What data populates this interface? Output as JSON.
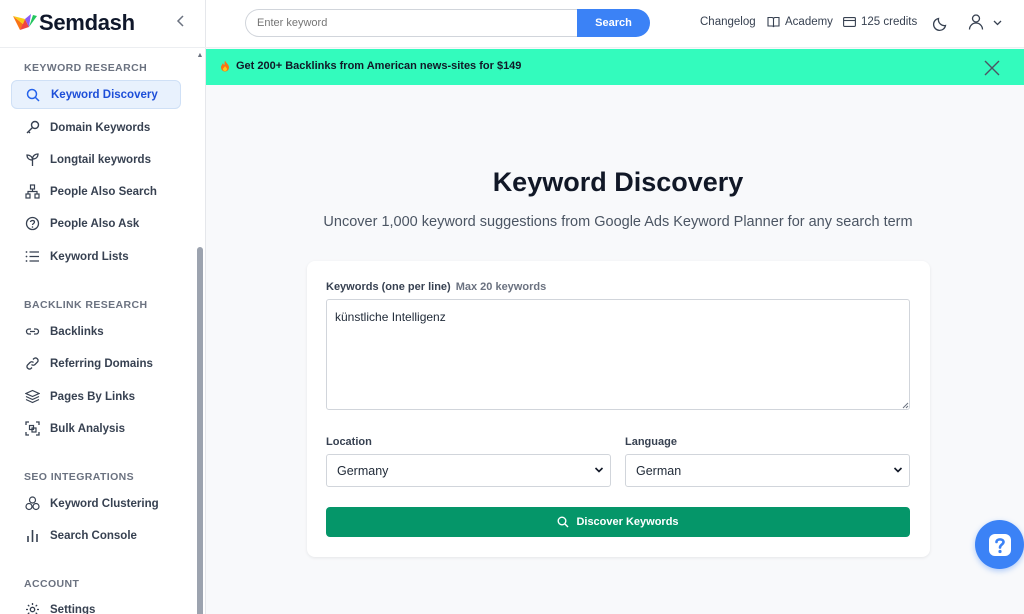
{
  "brand": {
    "name": "Semdash"
  },
  "topbar": {
    "search_placeholder": "Enter keyword",
    "search_button": "Search",
    "changelog": "Changelog",
    "academy": "Academy",
    "credits": "125 credits"
  },
  "banner": {
    "text": "Get 200+ Backlinks from American news-sites for $149"
  },
  "sidebar": {
    "sections": [
      {
        "title": "KEYWORD RESEARCH"
      },
      {
        "title": "BACKLINK RESEARCH"
      },
      {
        "title": "SEO INTEGRATIONS"
      },
      {
        "title": "ACCOUNT"
      }
    ],
    "items": [
      {
        "label": "Keyword Discovery",
        "icon": "search-icon"
      },
      {
        "label": "Domain Keywords",
        "icon": "key-icon"
      },
      {
        "label": "Longtail keywords",
        "icon": "sprout-icon"
      },
      {
        "label": "People Also Search",
        "icon": "network-icon"
      },
      {
        "label": "People Also Ask",
        "icon": "question-circle-icon"
      },
      {
        "label": "Keyword Lists",
        "icon": "list-icon"
      },
      {
        "label": "Backlinks",
        "icon": "link-icon"
      },
      {
        "label": "Referring Domains",
        "icon": "chain-icon"
      },
      {
        "label": "Pages By Links",
        "icon": "layers-icon"
      },
      {
        "label": "Bulk Analysis",
        "icon": "scan-icon"
      },
      {
        "label": "Keyword Clustering",
        "icon": "cluster-icon"
      },
      {
        "label": "Search Console",
        "icon": "bar-chart-icon"
      },
      {
        "label": "Settings",
        "icon": "gear-icon"
      }
    ]
  },
  "main": {
    "title": "Keyword Discovery",
    "subtitle": "Uncover 1,000 keyword suggestions from Google Ads Keyword Planner for any search term",
    "keywords_label": "Keywords (one per line)",
    "keywords_hint": "Max 20 keywords",
    "keywords_value": "künstliche Intelligenz",
    "location_label": "Location",
    "location_value": "Germany",
    "language_label": "Language",
    "language_value": "German",
    "discover_button": "Discover Keywords"
  },
  "colors": {
    "accent": "#3b82f6",
    "banner": "#33fbbd",
    "primary_button": "#059669"
  }
}
